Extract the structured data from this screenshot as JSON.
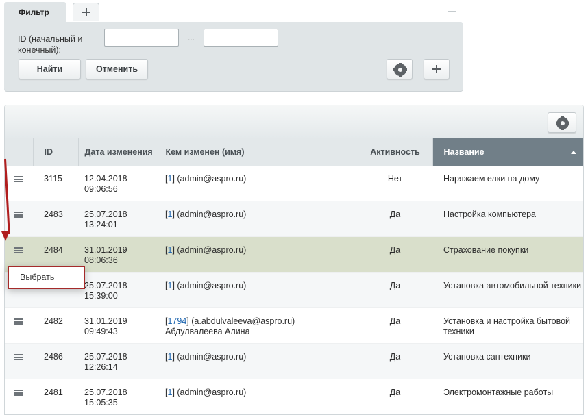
{
  "filter": {
    "tab_label": "Фильтр",
    "id_label": "ID (начальный и конечный):",
    "range_separator": "...",
    "find_button": "Найти",
    "cancel_button": "Отменить"
  },
  "grid": {
    "columns": [
      "ID",
      "Дата изменения",
      "Кем изменен (имя)",
      "Активность",
      "Название"
    ],
    "rows": [
      {
        "id": "3115",
        "date": "12.04.2018",
        "time": "09:06:56",
        "user_id": "1",
        "user": "(admin@aspro.ru)",
        "user_name": "",
        "active": "Нет",
        "name": "Наряжаем елки на дому"
      },
      {
        "id": "2483",
        "date": "25.07.2018",
        "time": "13:24:01",
        "user_id": "1",
        "user": "(admin@aspro.ru)",
        "user_name": "",
        "active": "Да",
        "name": "Настройка компьютера"
      },
      {
        "id": "2484",
        "date": "31.01.2019",
        "time": "08:06:36",
        "user_id": "1",
        "user": "(admin@aspro.ru)",
        "user_name": "",
        "active": "Да",
        "name": "Страхование покупки"
      },
      {
        "id": "",
        "date": "25.07.2018",
        "time": "15:39:00",
        "user_id": "1",
        "user": "(admin@aspro.ru)",
        "user_name": "",
        "active": "Да",
        "name": "Установка автомобильной техники"
      },
      {
        "id": "2482",
        "date": "31.01.2019",
        "time": "09:49:43",
        "user_id": "1794",
        "user": "(a.abdulvaleeva@aspro.ru)",
        "user_name": "Абдулвалеева Алина",
        "active": "Да",
        "name": "Установка и настройка бытовой техники"
      },
      {
        "id": "2486",
        "date": "25.07.2018",
        "time": "12:26:14",
        "user_id": "1",
        "user": "(admin@aspro.ru)",
        "user_name": "",
        "active": "Да",
        "name": "Установка сантехники"
      },
      {
        "id": "2481",
        "date": "25.07.2018",
        "time": "15:05:35",
        "user_id": "1",
        "user": "(admin@aspro.ru)",
        "user_name": "",
        "active": "Да",
        "name": "Электромонтажные работы"
      }
    ]
  },
  "context_menu": {
    "item": "Выбрать"
  },
  "colors": {
    "selected_row": "#d9dfcb",
    "sorted_header": "#717f88",
    "annotation": "#b01e1e",
    "link": "#2067b0"
  }
}
